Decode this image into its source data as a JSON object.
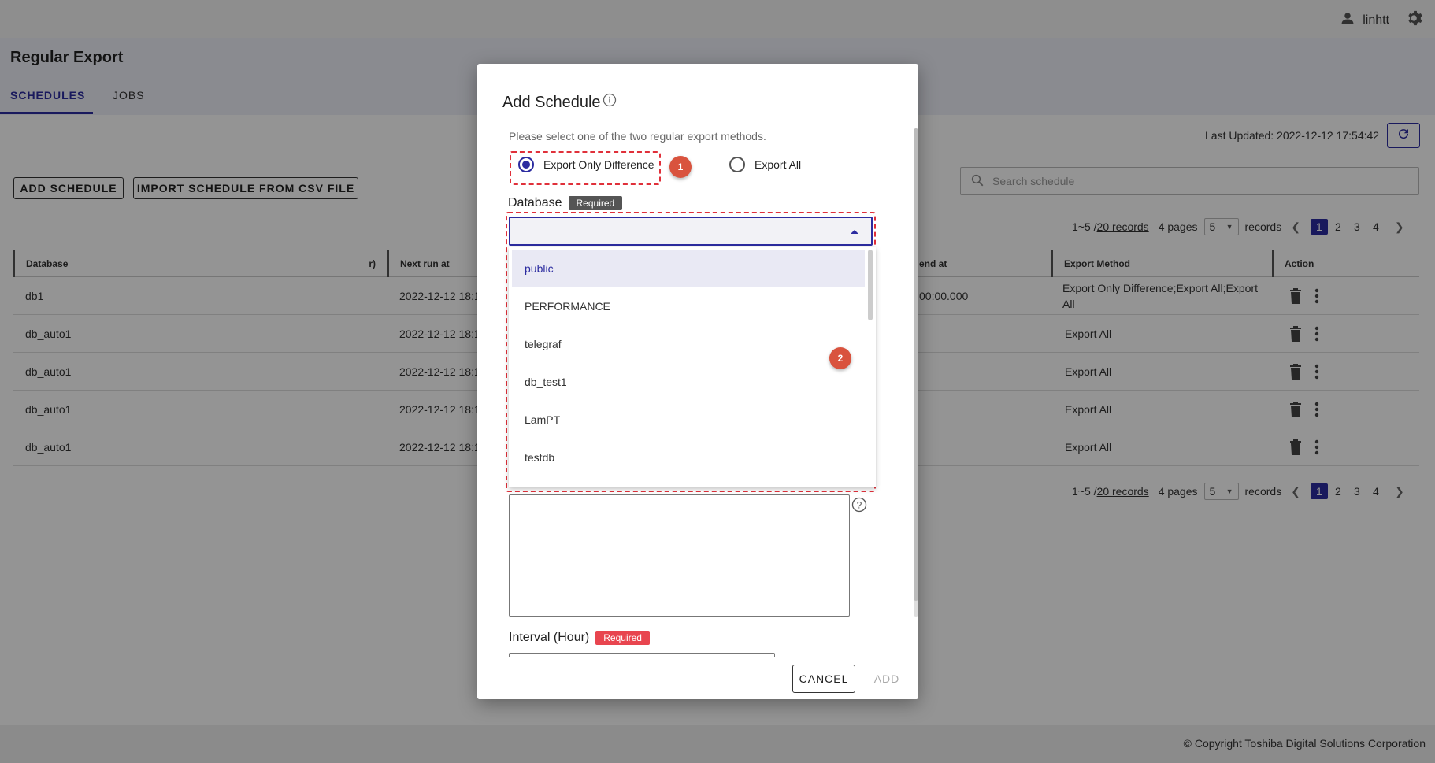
{
  "header": {
    "username": "linhtt"
  },
  "page": {
    "title": "Regular Export",
    "tabs": [
      {
        "label": "SCHEDULES"
      },
      {
        "label": "JOBS"
      }
    ],
    "last_updated": "Last Updated: 2022-12-12 17:54:42",
    "add_schedule_label": "ADD SCHEDULE",
    "import_label": "IMPORT SCHEDULE FROM CSV FILE",
    "search_placeholder": "Search schedule",
    "pagination": {
      "range": "1~5 / ",
      "records_link": "20 records",
      "pages": "4 pages",
      "page_size": "5",
      "records_suffix": "records",
      "page_numbers": [
        "1",
        "2",
        "3",
        "4"
      ],
      "current_page": "1"
    },
    "table": {
      "headers": {
        "database": "Database",
        "col2": "r)",
        "next_run": "Next run at",
        "end_at": "end at",
        "export_method": "Export Method",
        "action": "Action"
      },
      "rows": [
        {
          "database": "db1",
          "next_run": "2022-12-12 18:1",
          "end_at": "00:00.000",
          "export_method": "Export Only Difference;Export All;Export All"
        },
        {
          "database": "db_auto1",
          "next_run": "2022-12-12 18:1",
          "end_at": "",
          "export_method": "Export All"
        },
        {
          "database": "db_auto1",
          "next_run": "2022-12-12 18:1",
          "end_at": "",
          "export_method": "Export All"
        },
        {
          "database": "db_auto1",
          "next_run": "2022-12-12 18:1",
          "end_at": "",
          "export_method": "Export All"
        },
        {
          "database": "db_auto1",
          "next_run": "2022-12-12 18:1",
          "end_at": "",
          "export_method": "Export All"
        }
      ]
    }
  },
  "modal": {
    "title": "Add Schedule",
    "hint": "Please select one of the two regular export methods.",
    "export_methods": [
      {
        "label": "Export Only Difference",
        "checked": true
      },
      {
        "label": "Export All",
        "checked": false
      }
    ],
    "callouts": [
      "1",
      "2"
    ],
    "database_label": "Database",
    "required_label": "Required",
    "database_options": [
      "public",
      "PERFORMANCE",
      "telegraf",
      "db_test1",
      "LamPT",
      "testdb"
    ],
    "selected_option": "public",
    "interval_label": "Interval (Hour)",
    "cancel_label": "CANCEL",
    "add_label": "ADD"
  },
  "footer": {
    "copyright": "© Copyright Toshiba Digital Solutions Corporation"
  },
  "colors": {
    "accent": "#2c2ca0",
    "callout": "#d9533e",
    "dashed_highlight": "#e0303a",
    "required_red": "#e8454f"
  }
}
